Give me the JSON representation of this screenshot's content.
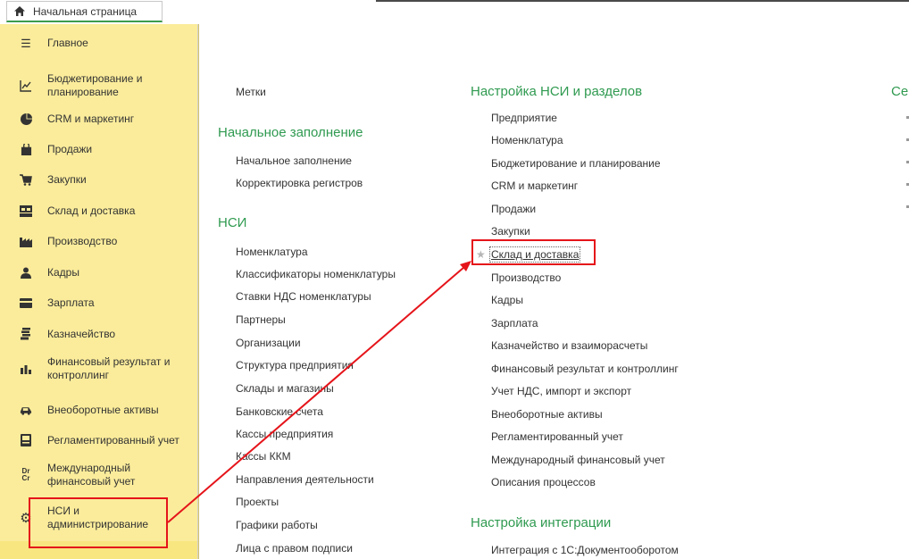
{
  "tabs": {
    "home_label": "Начальная страница"
  },
  "sidebar": {
    "items": [
      {
        "label": "Главное",
        "icon": "list-icon"
      },
      {
        "label": "Бюджетирование и\nпланирование",
        "icon": "budget-chart-icon"
      },
      {
        "label": "CRM и маркетинг",
        "icon": "crm-pie-icon"
      },
      {
        "label": "Продажи",
        "icon": "shopping-bag-icon"
      },
      {
        "label": "Закупки",
        "icon": "cart-icon"
      },
      {
        "label": "Склад и доставка",
        "icon": "warehouse-icon"
      },
      {
        "label": "Производство",
        "icon": "factory-icon"
      },
      {
        "label": "Кадры",
        "icon": "person-icon"
      },
      {
        "label": "Зарплата",
        "icon": "wallet-icon"
      },
      {
        "label": "Казначейство",
        "icon": "coins-icon"
      },
      {
        "label": "Финансовый результат и\nконтроллинг",
        "icon": "bar-chart-icon"
      },
      {
        "label": "Внеоборотные активы",
        "icon": "car-icon"
      },
      {
        "label": "Регламентированный учет",
        "icon": "printer-icon"
      },
      {
        "label": "Международный\nфинансовый учет",
        "icon": "dr-cr-icon"
      },
      {
        "label": "НСИ и\nадминистрирование",
        "icon": "gear-icon"
      }
    ],
    "dr": "Dr",
    "cr": "Cr"
  },
  "col1": {
    "tags_link": "Метки",
    "initial_heading": "Начальное заполнение",
    "initial_links": [
      "Начальное заполнение",
      "Корректировка регистров"
    ],
    "nsi_heading": "НСИ",
    "nsi_links": [
      "Номенклатура",
      "Классификаторы номенклатуры",
      "Ставки НДС номенклатуры",
      "Партнеры",
      "Организации",
      "Структура предприятия",
      "Склады и магазины",
      "Банковские счета",
      "Кассы предприятия",
      "Кассы ККМ",
      "Направления деятельности",
      "Проекты",
      "Графики работы",
      "Лица с правом подписи"
    ]
  },
  "col2": {
    "heading": "Настройка НСИ и разделов",
    "links": [
      "Предприятие",
      "Номенклатура",
      "Бюджетирование и планирование",
      "CRM и маркетинг",
      "Продажи",
      "Закупки",
      "Склад и доставка",
      "Производство",
      "Кадры",
      "Зарплата",
      "Казначейство и взаиморасчеты",
      "Финансовый результат и контроллинг",
      "Учет НДС, импорт и экспорт",
      "Внеоборотные активы",
      "Регламентированный учет",
      "Международный финансовый учет",
      "Описания процессов"
    ],
    "integration_heading": "Настройка интеграции",
    "integration_links": [
      "Интеграция с 1С:Документооборотом"
    ]
  },
  "col3": {
    "heading_partial": "Се"
  },
  "colors": {
    "sidebar_bg": "#fbec9b",
    "heading_green": "#2f9a50",
    "highlight_red": "#e5141a"
  }
}
